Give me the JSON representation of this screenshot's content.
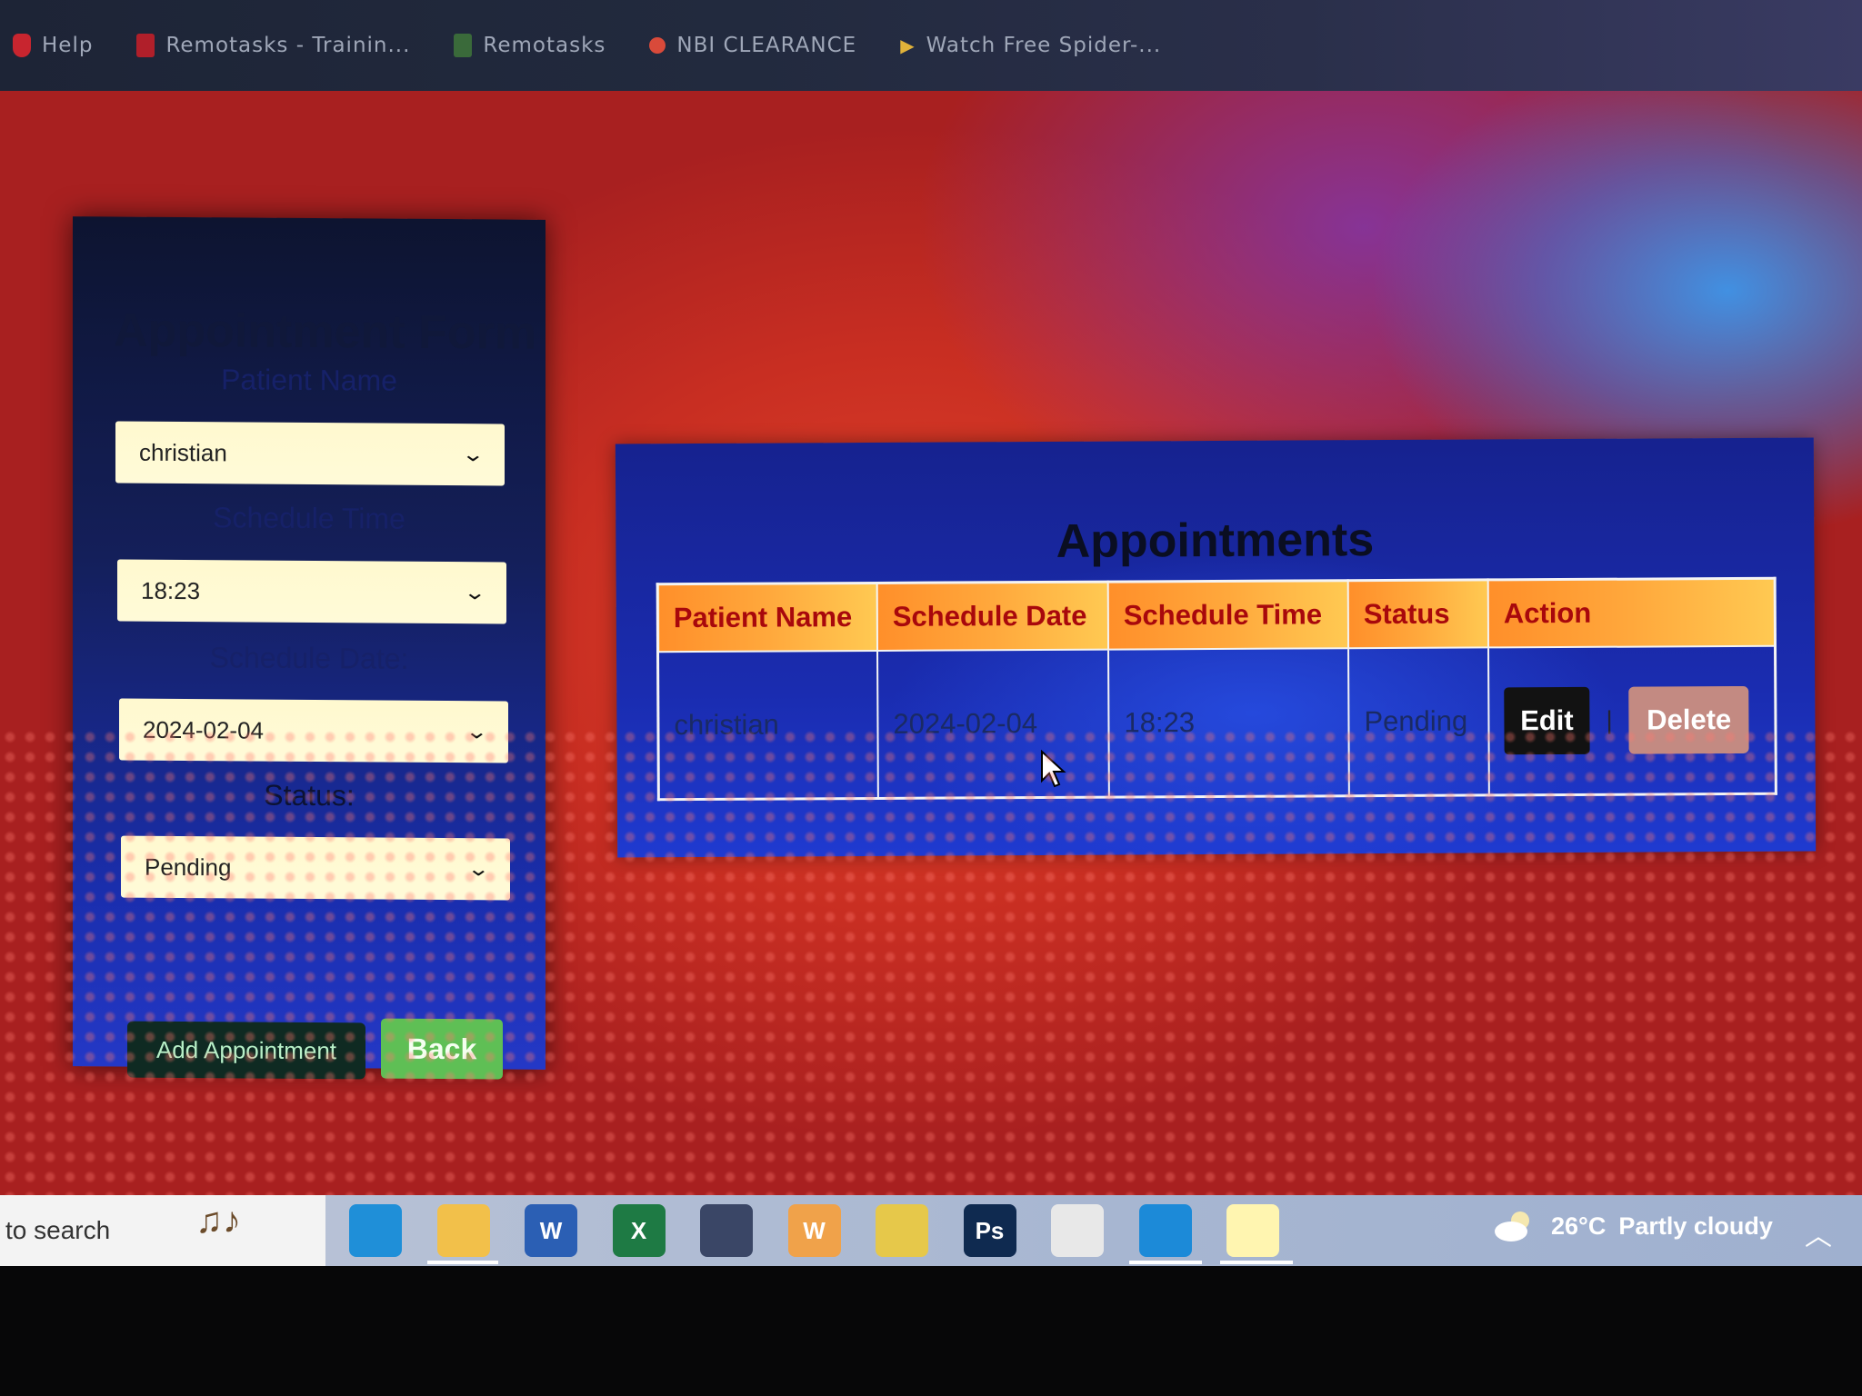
{
  "bookmarks": [
    {
      "label": "Help",
      "icon": "bookmark-heart-icon",
      "color": "#c8252f"
    },
    {
      "label": "Remotasks - Trainin...",
      "icon": "remotasks-icon",
      "color": "#b01f2a"
    },
    {
      "label": "Remotasks",
      "icon": "remotasks-icon",
      "color": "#3a6a3a"
    },
    {
      "label": "NBI CLEARANCE",
      "icon": "nbi-icon",
      "color": "#d94a3a"
    },
    {
      "label": "Watch Free Spider-...",
      "icon": "play-icon",
      "color": "#e0b23a"
    }
  ],
  "form": {
    "title": "Appointment Form",
    "patient_label": "Patient Name",
    "patient_value": "christian",
    "time_label": "Schedule Time",
    "time_value": "18:23",
    "date_label": "Schedule Date:",
    "date_value": "2024-02-04",
    "status_label": "Status:",
    "status_value": "Pending",
    "add_label": "Add Appointment",
    "back_label": "Back"
  },
  "appointments": {
    "title": "Appointments",
    "columns": [
      "Patient Name",
      "Schedule Date",
      "Schedule Time",
      "Status",
      "Action"
    ],
    "rows": [
      {
        "patient": "christian",
        "date": "2024-02-04",
        "time": "18:23",
        "status": "Pending"
      }
    ],
    "edit_label": "Edit",
    "separator": "|",
    "delete_label": "Delete"
  },
  "taskbar": {
    "search_text": "to search",
    "apps": [
      {
        "name": "edge-icon",
        "label": "",
        "color": "#1f8fd8"
      },
      {
        "name": "file-explorer-icon",
        "label": "",
        "color": "#f2c04a"
      },
      {
        "name": "word-icon",
        "label": "W",
        "color": "#2b5fb4"
      },
      {
        "name": "excel-icon",
        "label": "X",
        "color": "#1e7a44"
      },
      {
        "name": "speed-gauge-icon",
        "label": "",
        "color": "#3a4666"
      },
      {
        "name": "wps-icon",
        "label": "W",
        "color": "#f0a24a"
      },
      {
        "name": "chrome-icon",
        "label": "",
        "color": "#e6c84a"
      },
      {
        "name": "photoshop-icon",
        "label": "Ps",
        "color": "#0f2a50"
      },
      {
        "name": "chrome-profile-icon",
        "label": "",
        "color": "#e8e8e8"
      },
      {
        "name": "vscode-icon",
        "label": "",
        "color": "#1c8ad8"
      },
      {
        "name": "sticky-notes-icon",
        "label": "",
        "color": "#fff5b0"
      }
    ],
    "weather_temp": "26°C",
    "weather_desc": "Partly cloudy"
  }
}
